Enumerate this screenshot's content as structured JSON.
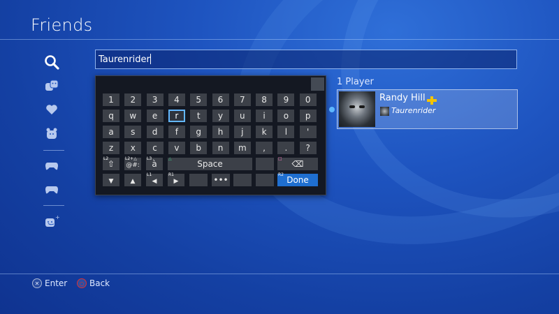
{
  "header": {
    "title": "Friends"
  },
  "sidebar": {
    "items": [
      {
        "name": "search-icon"
      },
      {
        "name": "friends-icon"
      },
      {
        "name": "favorites-heart-icon"
      },
      {
        "name": "friend-requests-icon"
      },
      {
        "name": "players-met-icon"
      },
      {
        "name": "game-controller-icon"
      },
      {
        "name": "add-friend-icon"
      }
    ]
  },
  "search": {
    "value": "Taurenrider"
  },
  "keyboard": {
    "rows": [
      [
        "1",
        "2",
        "3",
        "4",
        "5",
        "6",
        "7",
        "8",
        "9",
        "0"
      ],
      [
        "q",
        "w",
        "e",
        "r",
        "t",
        "y",
        "u",
        "i",
        "o",
        "p"
      ],
      [
        "a",
        "s",
        "d",
        "f",
        "g",
        "h",
        "j",
        "k",
        "l",
        "'"
      ],
      [
        "z",
        "x",
        "c",
        "v",
        "b",
        "n",
        "m",
        ",",
        ".",
        "?"
      ]
    ],
    "selected_key": "r",
    "close_label": "✕",
    "function_keys": {
      "l2_tag": "L2",
      "shift_label": "⇧",
      "l2_triangle_tag": "L2+△",
      "symbols_label": "@#:",
      "l3_tag": "L3",
      "accent_label": "à",
      "triangle_tag": "△",
      "space_label": "Space",
      "square_tag": "□",
      "backspace_label": "⌫",
      "down_label": "▼",
      "up_label": "▲",
      "l1_tag": "L1",
      "left_label": "◀",
      "r1_tag": "R1",
      "right_label": "▶",
      "more_label": "•••",
      "r2_tag": "R2",
      "done_label": "Done"
    }
  },
  "results": {
    "count_label": "1 Player",
    "friends": [
      {
        "name": "Randy Hill",
        "online_id": "Taurenrider",
        "ps_plus": true
      }
    ]
  },
  "footer": {
    "enter_label": "Enter",
    "back_label": "Back",
    "cross_symbol": "✕",
    "circle_symbol": "○"
  },
  "colors": {
    "background": "#1e54c0",
    "selected_key_outline": "#63b7ff",
    "done_key": "#1f6fd0",
    "ps_plus": "#f5c400",
    "circle_button": "#e03030"
  }
}
